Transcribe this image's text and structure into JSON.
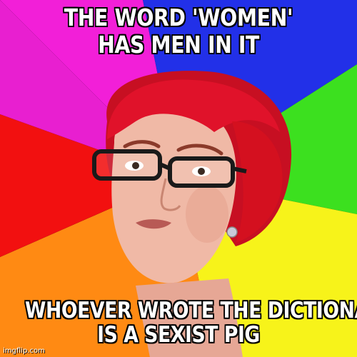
{
  "meme": {
    "top_text": [
      "THE WORD 'WOMEN'",
      "HAS MEN IN IT"
    ],
    "bottom_text": [
      "WHOEVER WROTE THE DICTIONARY",
      "IS A SEXIST PIG"
    ],
    "watermark": "imgflip.com"
  },
  "colors": {
    "pink": "#f21fd8",
    "blue": "#2230e8",
    "green": "#3ce01f",
    "yellow": "#f7f31a",
    "orange": "#ff8a13",
    "red": "#f21010",
    "hair": "#e0122a",
    "skin": "#f0b9a6"
  },
  "icons": {
    "background": "color-wheel-burst",
    "subject": "red-haired-woman-with-glasses"
  }
}
